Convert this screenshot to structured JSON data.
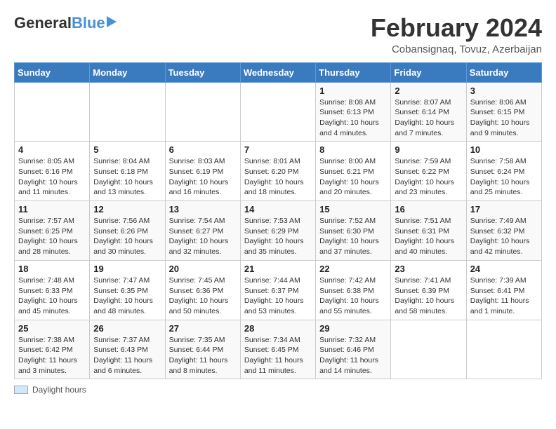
{
  "header": {
    "logo_general": "General",
    "logo_blue": "Blue",
    "title": "February 2024",
    "location": "Cobansignaq, Tovuz, Azerbaijan"
  },
  "days_of_week": [
    "Sunday",
    "Monday",
    "Tuesday",
    "Wednesday",
    "Thursday",
    "Friday",
    "Saturday"
  ],
  "legend_label": "Daylight hours",
  "weeks": [
    [
      {
        "day": "",
        "sunrise": "",
        "sunset": "",
        "daylight": ""
      },
      {
        "day": "",
        "sunrise": "",
        "sunset": "",
        "daylight": ""
      },
      {
        "day": "",
        "sunrise": "",
        "sunset": "",
        "daylight": ""
      },
      {
        "day": "",
        "sunrise": "",
        "sunset": "",
        "daylight": ""
      },
      {
        "day": "1",
        "sunrise": "Sunrise: 8:08 AM",
        "sunset": "Sunset: 6:13 PM",
        "daylight": "Daylight: 10 hours and 4 minutes."
      },
      {
        "day": "2",
        "sunrise": "Sunrise: 8:07 AM",
        "sunset": "Sunset: 6:14 PM",
        "daylight": "Daylight: 10 hours and 7 minutes."
      },
      {
        "day": "3",
        "sunrise": "Sunrise: 8:06 AM",
        "sunset": "Sunset: 6:15 PM",
        "daylight": "Daylight: 10 hours and 9 minutes."
      }
    ],
    [
      {
        "day": "4",
        "sunrise": "Sunrise: 8:05 AM",
        "sunset": "Sunset: 6:16 PM",
        "daylight": "Daylight: 10 hours and 11 minutes."
      },
      {
        "day": "5",
        "sunrise": "Sunrise: 8:04 AM",
        "sunset": "Sunset: 6:18 PM",
        "daylight": "Daylight: 10 hours and 13 minutes."
      },
      {
        "day": "6",
        "sunrise": "Sunrise: 8:03 AM",
        "sunset": "Sunset: 6:19 PM",
        "daylight": "Daylight: 10 hours and 16 minutes."
      },
      {
        "day": "7",
        "sunrise": "Sunrise: 8:01 AM",
        "sunset": "Sunset: 6:20 PM",
        "daylight": "Daylight: 10 hours and 18 minutes."
      },
      {
        "day": "8",
        "sunrise": "Sunrise: 8:00 AM",
        "sunset": "Sunset: 6:21 PM",
        "daylight": "Daylight: 10 hours and 20 minutes."
      },
      {
        "day": "9",
        "sunrise": "Sunrise: 7:59 AM",
        "sunset": "Sunset: 6:22 PM",
        "daylight": "Daylight: 10 hours and 23 minutes."
      },
      {
        "day": "10",
        "sunrise": "Sunrise: 7:58 AM",
        "sunset": "Sunset: 6:24 PM",
        "daylight": "Daylight: 10 hours and 25 minutes."
      }
    ],
    [
      {
        "day": "11",
        "sunrise": "Sunrise: 7:57 AM",
        "sunset": "Sunset: 6:25 PM",
        "daylight": "Daylight: 10 hours and 28 minutes."
      },
      {
        "day": "12",
        "sunrise": "Sunrise: 7:56 AM",
        "sunset": "Sunset: 6:26 PM",
        "daylight": "Daylight: 10 hours and 30 minutes."
      },
      {
        "day": "13",
        "sunrise": "Sunrise: 7:54 AM",
        "sunset": "Sunset: 6:27 PM",
        "daylight": "Daylight: 10 hours and 32 minutes."
      },
      {
        "day": "14",
        "sunrise": "Sunrise: 7:53 AM",
        "sunset": "Sunset: 6:29 PM",
        "daylight": "Daylight: 10 hours and 35 minutes."
      },
      {
        "day": "15",
        "sunrise": "Sunrise: 7:52 AM",
        "sunset": "Sunset: 6:30 PM",
        "daylight": "Daylight: 10 hours and 37 minutes."
      },
      {
        "day": "16",
        "sunrise": "Sunrise: 7:51 AM",
        "sunset": "Sunset: 6:31 PM",
        "daylight": "Daylight: 10 hours and 40 minutes."
      },
      {
        "day": "17",
        "sunrise": "Sunrise: 7:49 AM",
        "sunset": "Sunset: 6:32 PM",
        "daylight": "Daylight: 10 hours and 42 minutes."
      }
    ],
    [
      {
        "day": "18",
        "sunrise": "Sunrise: 7:48 AM",
        "sunset": "Sunset: 6:33 PM",
        "daylight": "Daylight: 10 hours and 45 minutes."
      },
      {
        "day": "19",
        "sunrise": "Sunrise: 7:47 AM",
        "sunset": "Sunset: 6:35 PM",
        "daylight": "Daylight: 10 hours and 48 minutes."
      },
      {
        "day": "20",
        "sunrise": "Sunrise: 7:45 AM",
        "sunset": "Sunset: 6:36 PM",
        "daylight": "Daylight: 10 hours and 50 minutes."
      },
      {
        "day": "21",
        "sunrise": "Sunrise: 7:44 AM",
        "sunset": "Sunset: 6:37 PM",
        "daylight": "Daylight: 10 hours and 53 minutes."
      },
      {
        "day": "22",
        "sunrise": "Sunrise: 7:42 AM",
        "sunset": "Sunset: 6:38 PM",
        "daylight": "Daylight: 10 hours and 55 minutes."
      },
      {
        "day": "23",
        "sunrise": "Sunrise: 7:41 AM",
        "sunset": "Sunset: 6:39 PM",
        "daylight": "Daylight: 10 hours and 58 minutes."
      },
      {
        "day": "24",
        "sunrise": "Sunrise: 7:39 AM",
        "sunset": "Sunset: 6:41 PM",
        "daylight": "Daylight: 11 hours and 1 minute."
      }
    ],
    [
      {
        "day": "25",
        "sunrise": "Sunrise: 7:38 AM",
        "sunset": "Sunset: 6:42 PM",
        "daylight": "Daylight: 11 hours and 3 minutes."
      },
      {
        "day": "26",
        "sunrise": "Sunrise: 7:37 AM",
        "sunset": "Sunset: 6:43 PM",
        "daylight": "Daylight: 11 hours and 6 minutes."
      },
      {
        "day": "27",
        "sunrise": "Sunrise: 7:35 AM",
        "sunset": "Sunset: 6:44 PM",
        "daylight": "Daylight: 11 hours and 8 minutes."
      },
      {
        "day": "28",
        "sunrise": "Sunrise: 7:34 AM",
        "sunset": "Sunset: 6:45 PM",
        "daylight": "Daylight: 11 hours and 11 minutes."
      },
      {
        "day": "29",
        "sunrise": "Sunrise: 7:32 AM",
        "sunset": "Sunset: 6:46 PM",
        "daylight": "Daylight: 11 hours and 14 minutes."
      },
      {
        "day": "",
        "sunrise": "",
        "sunset": "",
        "daylight": ""
      },
      {
        "day": "",
        "sunrise": "",
        "sunset": "",
        "daylight": ""
      }
    ]
  ]
}
